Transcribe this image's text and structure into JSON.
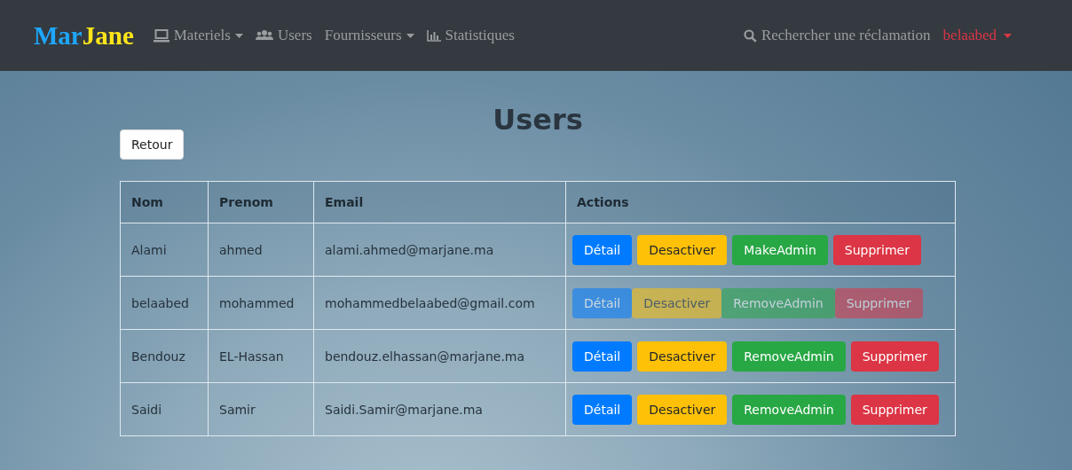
{
  "navbar": {
    "brand": [
      "Mar",
      "Jane"
    ],
    "items": [
      {
        "label": "Materiels",
        "dropdown": true
      },
      {
        "label": "Users",
        "dropdown": false
      },
      {
        "label": "Fournisseurs",
        "dropdown": true
      },
      {
        "label": "Statistiques",
        "dropdown": false
      }
    ],
    "search": {
      "label": "Rechercher une réclamation"
    },
    "user": {
      "label": "belaabed",
      "dropdown": true
    }
  },
  "page": {
    "title": "Users",
    "back_button": "Retour"
  },
  "table": {
    "columns": [
      "Nom",
      "Prenom",
      "Email",
      "Actions"
    ],
    "rows": [
      {
        "cells": [
          "Alami",
          "ahmed",
          "alami.ahmed@marjane.ma"
        ],
        "disabled": false,
        "actions": [
          {
            "label": "Détail",
            "kind": "primary"
          },
          {
            "label": "Desactiver",
            "kind": "warning"
          },
          {
            "label": "MakeAdmin",
            "kind": "success"
          },
          {
            "label": "Supprimer",
            "kind": "danger"
          }
        ]
      },
      {
        "cells": [
          "belaabed",
          "mohammed",
          "mohammedbelaabed@gmail.com"
        ],
        "disabled": true,
        "actions": [
          {
            "label": "Détail",
            "kind": "primary"
          },
          {
            "label": "Desactiver",
            "kind": "warning"
          },
          {
            "label": "RemoveAdmin",
            "kind": "success"
          },
          {
            "label": "Supprimer",
            "kind": "danger"
          }
        ]
      },
      {
        "cells": [
          "Bendouz",
          "EL-Hassan",
          "bendouz.elhassan@marjane.ma"
        ],
        "disabled": false,
        "actions": [
          {
            "label": "Détail",
            "kind": "primary"
          },
          {
            "label": "Desactiver",
            "kind": "warning"
          },
          {
            "label": "RemoveAdmin",
            "kind": "success"
          },
          {
            "label": "Supprimer",
            "kind": "danger"
          }
        ]
      },
      {
        "cells": [
          "Saidi",
          "Samir",
          "Saidi.Samir@marjane.ma"
        ],
        "disabled": false,
        "actions": [
          {
            "label": "Détail",
            "kind": "primary"
          },
          {
            "label": "Desactiver",
            "kind": "warning"
          },
          {
            "label": "RemoveAdmin",
            "kind": "success"
          },
          {
            "label": "Supprimer",
            "kind": "danger"
          }
        ]
      }
    ]
  }
}
